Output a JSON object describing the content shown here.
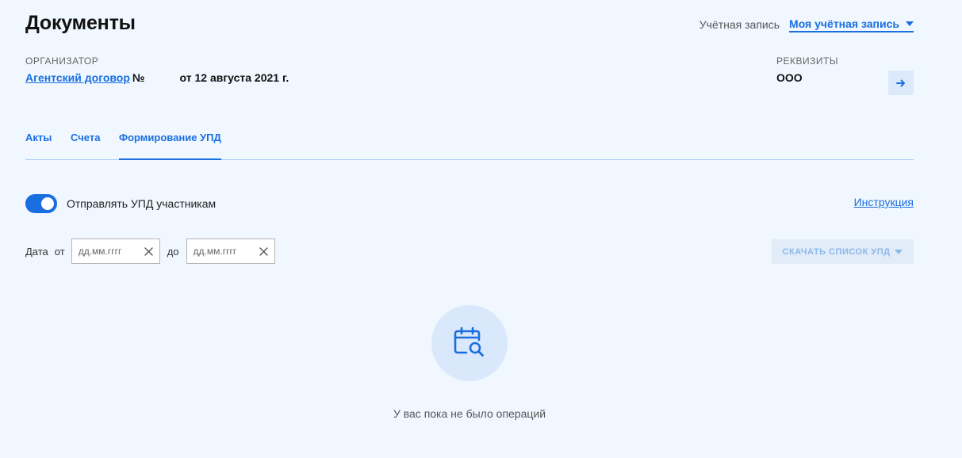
{
  "header": {
    "title": "Документы",
    "account_label": "Учётная запись",
    "account_value": "Моя учётная запись"
  },
  "organizer": {
    "label": "ОРГАНИЗАТОР",
    "contract_link": "Агентский договор",
    "number_sign": "№",
    "date": "от 12 августа 2021 г."
  },
  "requisites": {
    "label": "РЕКВИЗИТЫ",
    "value": "ООО"
  },
  "tabs": [
    {
      "label": "Акты",
      "active": false
    },
    {
      "label": "Счета",
      "active": false
    },
    {
      "label": "Формирование УПД",
      "active": true
    }
  ],
  "toggle": {
    "label": "Отправлять УПД участникам",
    "checked": true
  },
  "instruction_link": "Инструкция",
  "filters": {
    "date_label": "Дата",
    "from_label": "от",
    "to_label": "до",
    "from_placeholder": "дд.мм.гггг",
    "to_placeholder": "дд.мм.гггг"
  },
  "download_button": "СКАЧАТЬ СПИСОК УПД",
  "empty_state": {
    "icon": "calendar-search-icon",
    "text": "У вас пока не было операций"
  },
  "colors": {
    "accent": "#1a6fe0",
    "background": "#f0f7ff",
    "disabled_text": "#8bb8ea"
  }
}
